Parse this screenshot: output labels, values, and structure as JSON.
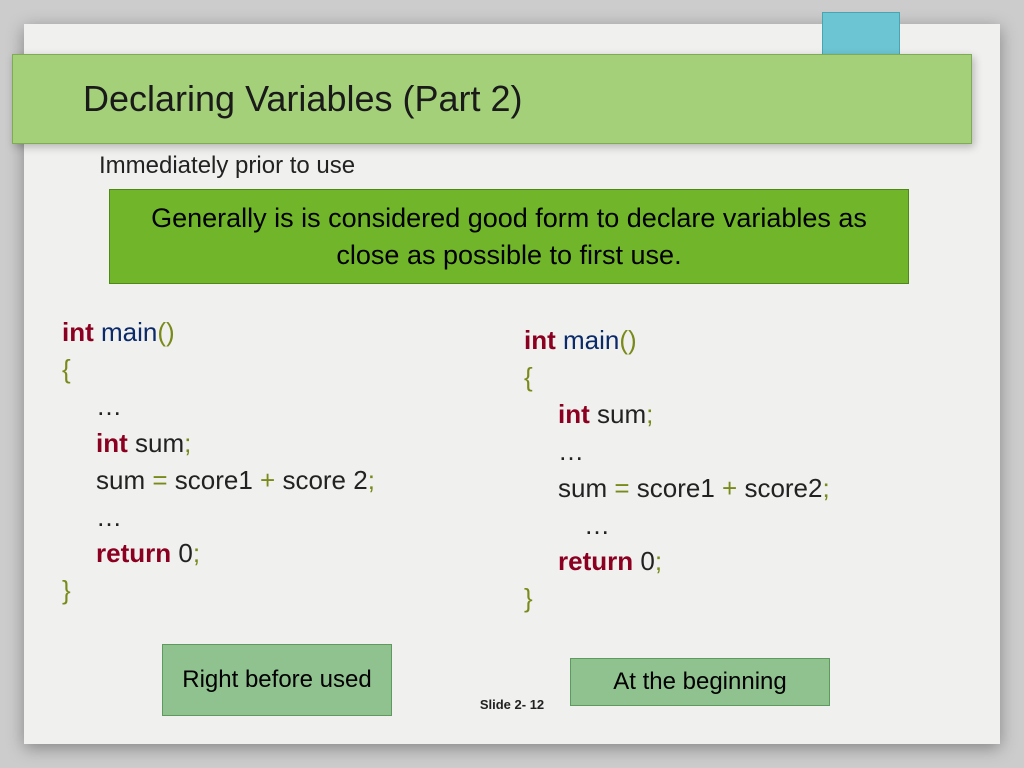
{
  "title": "Declaring Variables (Part 2)",
  "subtitle": "Immediately prior to use",
  "callout": "Generally is is considered good form to declare variables as close as possible to first use.",
  "code_left": {
    "l1_kw": "int",
    "l1_fn": " main",
    "l1_p1": "()",
    "l2": "{",
    "l3": "…",
    "l4_kw": "int",
    "l4_var": " sum",
    "l4_p": ";",
    "l5_a": "sum ",
    "l5_eq": "=",
    "l5_b": " score1 ",
    "l5_plus": "+",
    "l5_c": " score 2",
    "l5_p": ";",
    "l6": "…",
    "l7_kw": "return",
    "l7_v": " 0",
    "l7_p": ";",
    "l8": "}"
  },
  "code_right": {
    "l1_kw": "int",
    "l1_fn": " main",
    "l1_p1": "()",
    "l2": "{",
    "l3_kw": "int",
    "l3_var": " sum",
    "l3_p": ";",
    "l4": "…",
    "l5_a": "sum ",
    "l5_eq": "=",
    "l5_b": " score1 ",
    "l5_plus": "+",
    "l5_c": " score2",
    "l5_p": ";",
    "l6": "…",
    "l7_kw": "return",
    "l7_v": " 0",
    "l7_p": ";",
    "l8": "}"
  },
  "label_left": "Right before used",
  "label_right": "At the beginning",
  "footer": "Slide 2- 12"
}
